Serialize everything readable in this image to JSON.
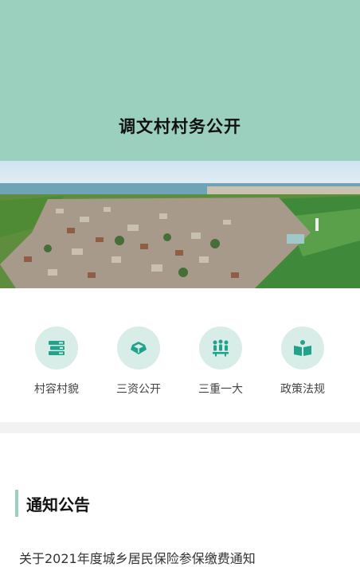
{
  "header": {
    "title": "调文村村务公开"
  },
  "nav": {
    "items": [
      {
        "label": "村容村貌",
        "icon": "books-icon"
      },
      {
        "label": "三资公开",
        "icon": "open-box-icon"
      },
      {
        "label": "三重一大",
        "icon": "people-meeting-icon"
      },
      {
        "label": "政策法规",
        "icon": "open-book-icon"
      }
    ]
  },
  "notices": {
    "title": "通知公告",
    "items": [
      "关于2021年度城乡居民保险参保缴费通知"
    ]
  },
  "colors": {
    "header_bg": "#9bcfbe",
    "accent": "#21a28a",
    "icon_bg": "#d8ede7"
  }
}
